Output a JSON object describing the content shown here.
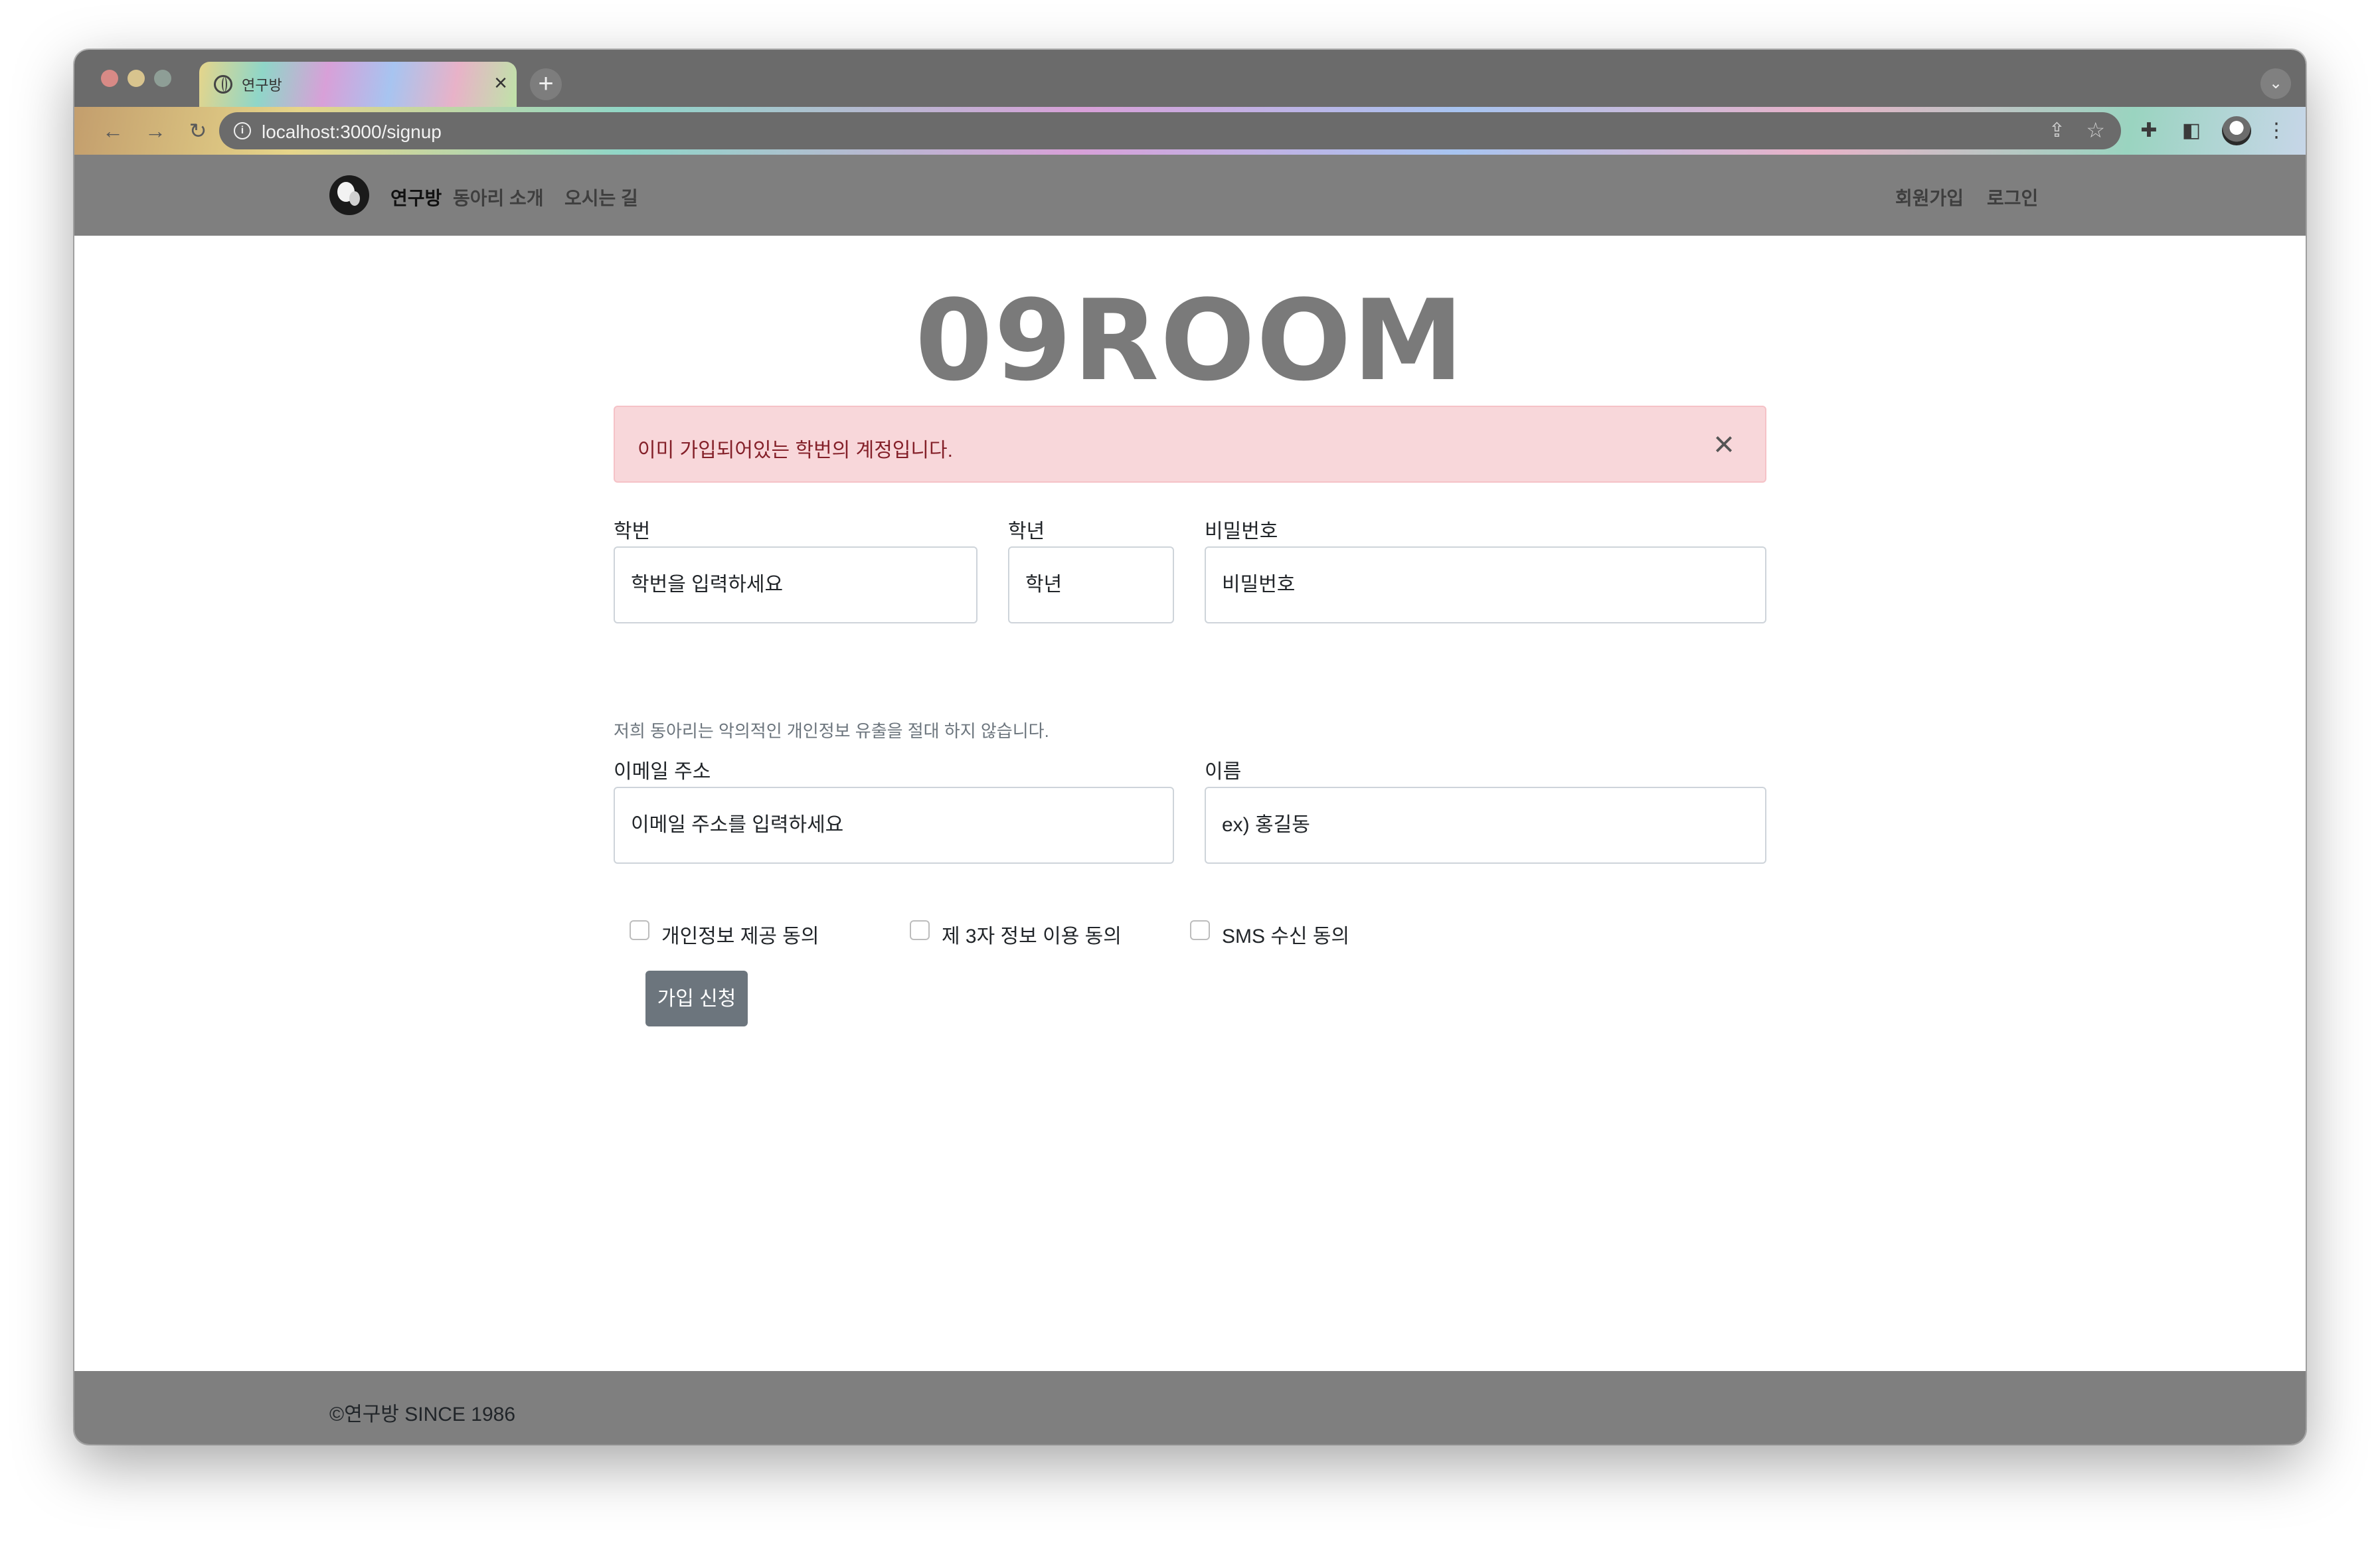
{
  "browser": {
    "tab_title": "연구방",
    "tab_close": "×",
    "new_tab": "+",
    "tab_search": "⌄",
    "url": "localhost:3000/signup",
    "icons": [
      "back-icon",
      "forward-icon",
      "reload-icon",
      "info-icon",
      "share-icon",
      "star-icon",
      "extensions-icon",
      "sidepanel-icon",
      "profile-avatar",
      "menu-icon"
    ]
  },
  "navbar": {
    "brand": "연구방",
    "links": [
      "동아리 소개",
      "오시는 길"
    ],
    "right_links": [
      "회원가입",
      "로그인"
    ]
  },
  "hero": {
    "title": "09ROOM"
  },
  "alert": {
    "message": "이미 가입되어있는 학번의 계정입니다.",
    "close": "×",
    "colors": {
      "background": "#f8d7da",
      "text": "#842029"
    }
  },
  "form": {
    "student_id": {
      "label": "학번",
      "placeholder": "학번을 입력하세요"
    },
    "grade": {
      "label": "학년",
      "placeholder": "학년"
    },
    "password": {
      "label": "비밀번호",
      "placeholder": "비밀번호"
    },
    "notice": "저희 동아리는 악의적인 개인정보 유출을 절대 하지 않습니다.",
    "email": {
      "label": "이메일 주소",
      "placeholder": "이메일 주소를 입력하세요"
    },
    "name": {
      "label": "이름",
      "placeholder": "ex) 홍길동"
    },
    "checkboxes": [
      "개인정보 제공 동의",
      "제 3자 정보 이용 동의",
      "SMS 수신 동의"
    ],
    "submit": "가입 신청"
  },
  "footer": {
    "text": "©연구방 SINCE 1986"
  },
  "colors": {
    "navbar": "#7f7f7f",
    "hero": "#7a7a7a",
    "button": "#6c757d"
  }
}
